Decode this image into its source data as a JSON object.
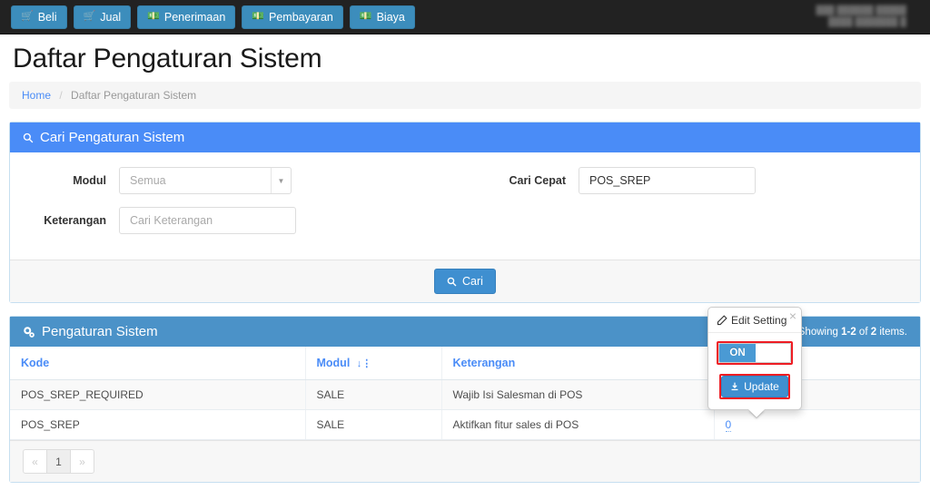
{
  "navbar": {
    "buttons": [
      {
        "label": "Beli",
        "icon": "cart-icon"
      },
      {
        "label": "Jual",
        "icon": "cart-icon"
      },
      {
        "label": "Penerimaan",
        "icon": "money-icon"
      },
      {
        "label": "Pembayaran",
        "icon": "money-icon"
      },
      {
        "label": "Biaya",
        "icon": "money-icon"
      }
    ],
    "user_line1": "███ ██████ █████",
    "user_line2": "████ ███████ █"
  },
  "page": {
    "title": "Daftar Pengaturan Sistem",
    "breadcrumb_home": "Home",
    "breadcrumb_sep": "/",
    "breadcrumb_current": "Daftar Pengaturan Sistem"
  },
  "search_panel": {
    "heading": "Cari Pengaturan Sistem",
    "heading_icon": "search-icon",
    "modul_label": "Modul",
    "modul_value": "Semua",
    "keterangan_label": "Keterangan",
    "keterangan_placeholder": "Cari Keterangan",
    "keterangan_value": "",
    "cari_cepat_label": "Cari Cepat",
    "cari_cepat_value": "POS_SREP",
    "submit_label": "Cari",
    "submit_icon": "search-icon"
  },
  "result_panel": {
    "heading": "Pengaturan Sistem",
    "heading_icon": "gears-icon",
    "showing_prefix": "Showing",
    "showing_range": "1-2",
    "showing_of": "of",
    "showing_total": "2",
    "showing_suffix": "items.",
    "columns": [
      "Kode",
      "Modul",
      "Keterangan"
    ],
    "sort_icon": "sort-amount-icon",
    "rows": [
      {
        "kode": "POS_SREP_REQUIRED",
        "modul": "SALE",
        "keterangan": "Wajib Isi Salesman di POS",
        "nilai": ""
      },
      {
        "kode": "POS_SREP",
        "modul": "SALE",
        "keterangan": "Aktifkan fitur sales di POS",
        "nilai": "0"
      }
    ],
    "pager": {
      "prev": "«",
      "page": "1",
      "next": "»"
    }
  },
  "popover": {
    "title": "Edit Setting",
    "title_icon": "edit-icon",
    "close_icon": "close-icon",
    "toggle_state": "ON",
    "update_label": "Update",
    "update_icon": "download-icon"
  },
  "colors": {
    "navbar_bg": "#222222",
    "nav_button": "#3c8dbc",
    "search_panel_header": "#4a8cf7",
    "result_panel_header": "#4b92c8",
    "primary_button": "#3f8fd0",
    "link": "#4a8cf7",
    "highlight_outline": "#ee1c23",
    "toggle_on": "#4a9ad4"
  }
}
